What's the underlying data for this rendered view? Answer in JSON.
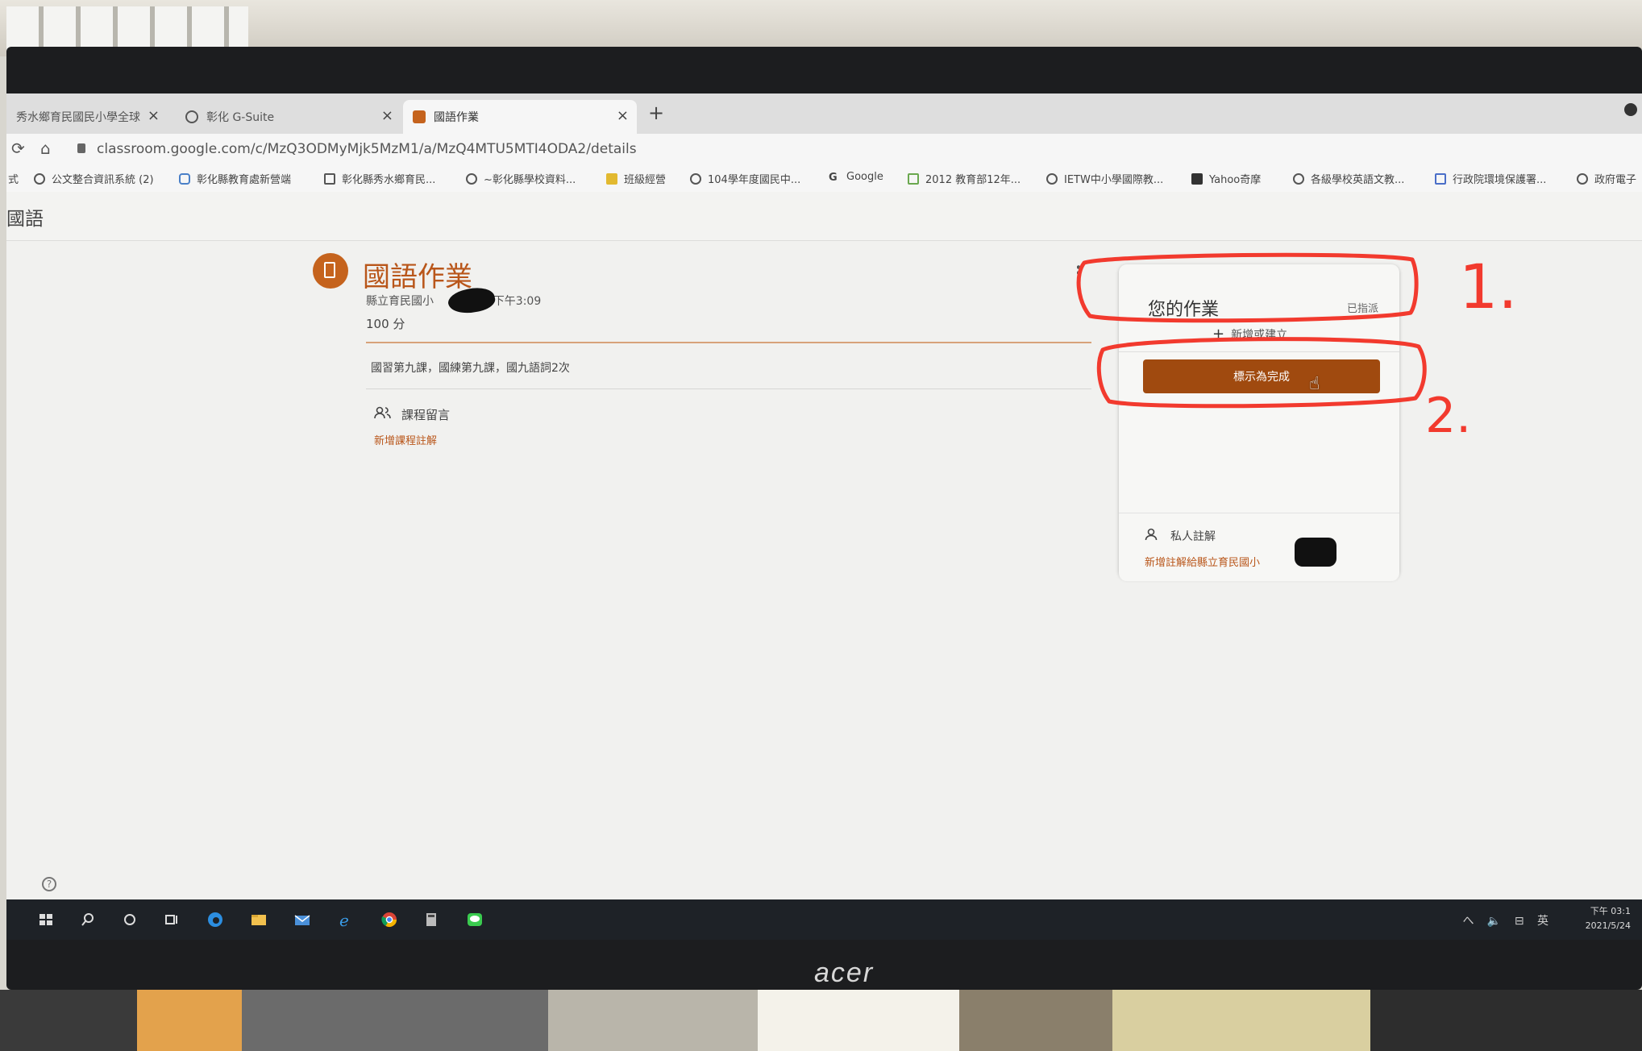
{
  "browser": {
    "tabs": [
      {
        "label": "秀水鄉育民國民小學全球",
        "close": "×"
      },
      {
        "label": "彰化 G-Suite",
        "close": "×"
      },
      {
        "label": "國語作業",
        "close": "×"
      }
    ],
    "new_tab": "+",
    "url": "classroom.google.com/c/MzQ3ODMyMjk5MzM1/a/MzQ4MTU5MTI4ODA2/details",
    "bookmarks": [
      "式",
      "公文整合資訊系統 (2)",
      "彰化縣教育處新營端",
      "彰化縣秀水鄉育民...",
      "~彰化縣學校資料...",
      "班級經營",
      "104學年度國民中...",
      "Google",
      "2012 教育部12年...",
      "IETW中小學國際教...",
      "Yahoo奇摩",
      "各級學校英語文教...",
      "行政院環境保護署...",
      "政府電子"
    ]
  },
  "classroom": {
    "class_name": "國語",
    "assignment": {
      "title": "國語作業",
      "meta": "縣立育民國小",
      "time": "· 下午3:09",
      "points": "100 分",
      "description": "國習第九課，國練第九課，國九語詞2次",
      "comments_label": "課程留言",
      "add_comment": "新增課程註解"
    },
    "your_work": {
      "title": "您的作業",
      "status": "已指派",
      "add_or_create": "新增或建立",
      "mark_done": "標示為完成",
      "private_comments_label": "私人註解",
      "add_private_comment": "新增註解給縣立育民國小"
    },
    "help": "?"
  },
  "taskbar": {
    "tray_icons": "へ 🔈 ⊟ 英",
    "time": "下午 03:1",
    "date": "2021/5/24"
  },
  "monitor": {
    "brand": "acer"
  },
  "annotations": {
    "label_1": "1.",
    "label_2": "2.",
    "color": "#f23a2e"
  }
}
